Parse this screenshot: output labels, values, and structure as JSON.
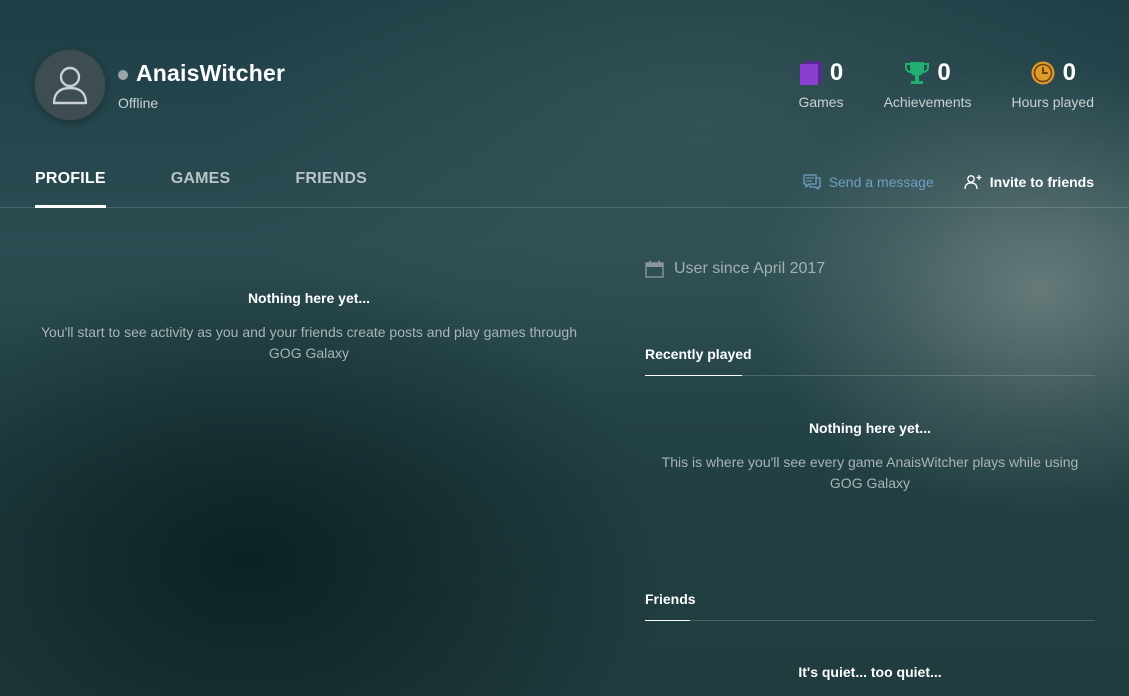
{
  "profile": {
    "username": "AnaisWitcher",
    "status": "Offline"
  },
  "stats": [
    {
      "icon": "games-icon",
      "value": "0",
      "label": "Games",
      "color": "#8a3fd1"
    },
    {
      "icon": "trophy-icon",
      "value": "0",
      "label": "Achievements",
      "color": "#1fb070"
    },
    {
      "icon": "clock-icon",
      "value": "0",
      "label": "Hours played",
      "color": "#e09a2a"
    }
  ],
  "tabs": [
    {
      "label": "PROFILE",
      "active": true
    },
    {
      "label": "GAMES",
      "active": false
    },
    {
      "label": "FRIENDS",
      "active": false
    }
  ],
  "actions": {
    "send_message": "Send a message",
    "invite": "Invite to friends"
  },
  "feed": {
    "empty_title": "Nothing here yet...",
    "empty_desc": "You'll start to see activity as you and your friends create posts and play games through GOG Galaxy"
  },
  "sidebar": {
    "member_since": "User since April 2017",
    "recently_played": {
      "title": "Recently played",
      "empty_title": "Nothing here yet...",
      "empty_desc": "This is where you'll see every game AnaisWitcher plays while using GOG Galaxy"
    },
    "friends": {
      "title": "Friends",
      "empty_title": "It's quiet... too quiet..."
    }
  },
  "colors": {
    "accent_link": "#6e9fc3",
    "status_offline": "#9aa4a6"
  }
}
